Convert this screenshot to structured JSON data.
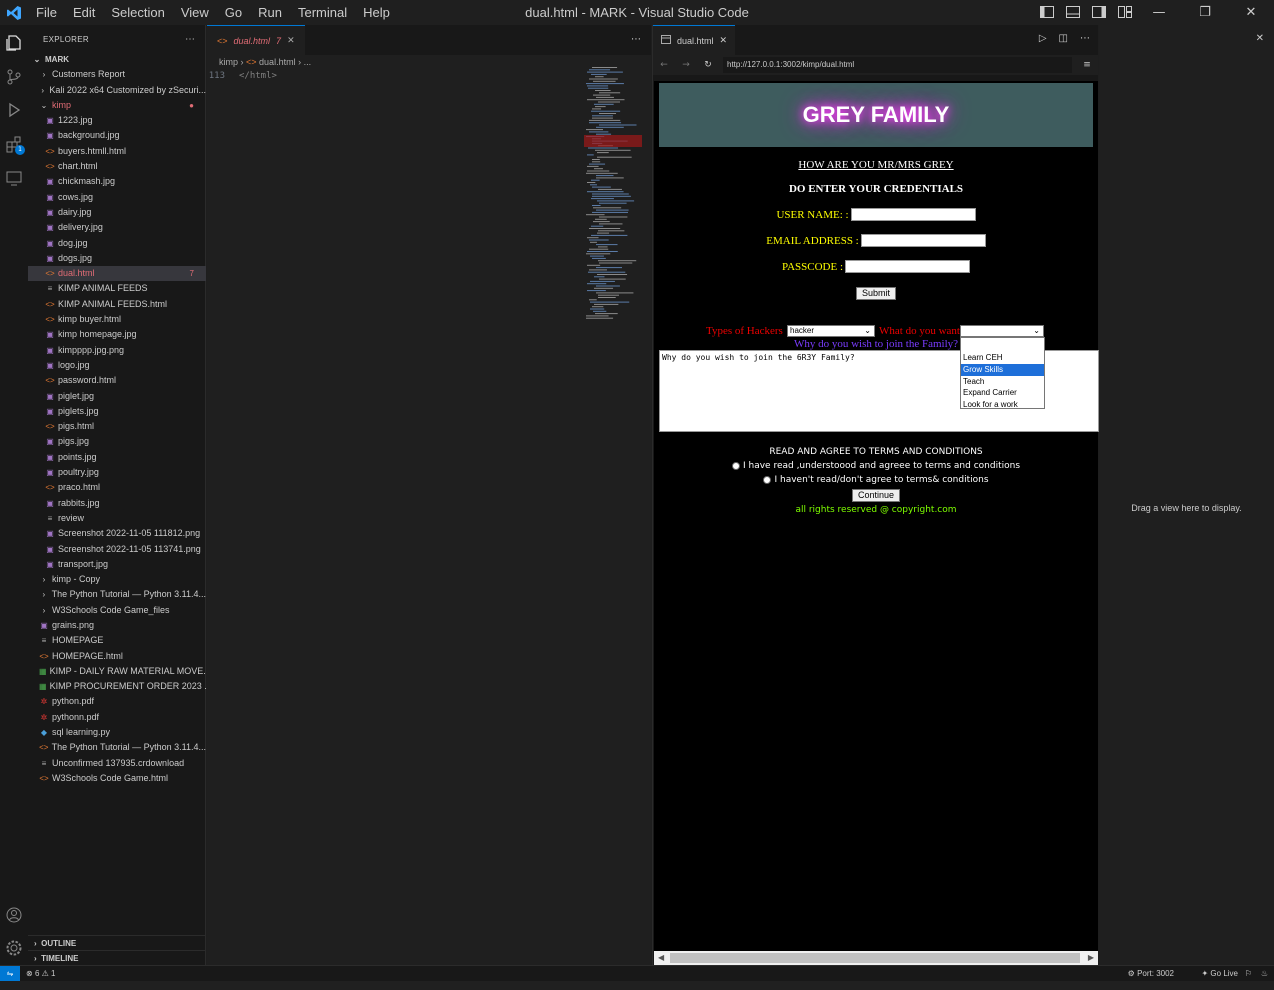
{
  "window": {
    "title": "dual.html - MARK - Visual Studio Code",
    "menu": [
      "File",
      "Edit",
      "Selection",
      "View",
      "Go",
      "Run",
      "Terminal",
      "Help"
    ]
  },
  "activity_bar": {
    "extensions_badge": "1"
  },
  "explorer": {
    "header": "EXPLORER",
    "root": "MARK",
    "items": [
      {
        "label": "Customers Report",
        "kind": "folder",
        "depth": 1
      },
      {
        "label": "Kali 2022 x64 Customized by zSecuri...",
        "kind": "folder",
        "depth": 1
      },
      {
        "label": "kimp",
        "kind": "folder-open",
        "depth": 1
      },
      {
        "label": "1223.jpg",
        "kind": "image",
        "depth": 2
      },
      {
        "label": "background.jpg",
        "kind": "image",
        "depth": 2
      },
      {
        "label": "buyers.htmll.html",
        "kind": "html",
        "depth": 2
      },
      {
        "label": "chart.html",
        "kind": "html",
        "depth": 2
      },
      {
        "label": "chickmash.jpg",
        "kind": "image",
        "depth": 2
      },
      {
        "label": "cows.jpg",
        "kind": "image",
        "depth": 2
      },
      {
        "label": "dairy.jpg",
        "kind": "image",
        "depth": 2
      },
      {
        "label": "delivery.jpg",
        "kind": "image",
        "depth": 2
      },
      {
        "label": "dog.jpg",
        "kind": "image",
        "depth": 2
      },
      {
        "label": "dogs.jpg",
        "kind": "image",
        "depth": 2
      },
      {
        "label": "dual.html",
        "kind": "html",
        "depth": 2,
        "badge": "7",
        "selected": true
      },
      {
        "label": "KIMP ANIMAL FEEDS",
        "kind": "text",
        "depth": 2
      },
      {
        "label": "KIMP ANIMAL FEEDS.html",
        "kind": "html",
        "depth": 2
      },
      {
        "label": "kimp buyer.html",
        "kind": "html",
        "depth": 2
      },
      {
        "label": "kimp homepage.jpg",
        "kind": "image",
        "depth": 2
      },
      {
        "label": "kimpppp.jpg.png",
        "kind": "image",
        "depth": 2
      },
      {
        "label": "logo.jpg",
        "kind": "image",
        "depth": 2
      },
      {
        "label": "password.html",
        "kind": "html",
        "depth": 2
      },
      {
        "label": "piglet.jpg",
        "kind": "image",
        "depth": 2
      },
      {
        "label": "piglets.jpg",
        "kind": "image",
        "depth": 2
      },
      {
        "label": "pigs.html",
        "kind": "html",
        "depth": 2
      },
      {
        "label": "pigs.jpg",
        "kind": "image",
        "depth": 2
      },
      {
        "label": "points.jpg",
        "kind": "image",
        "depth": 2
      },
      {
        "label": "poultry.jpg",
        "kind": "image",
        "depth": 2
      },
      {
        "label": "praco.html",
        "kind": "html",
        "depth": 2
      },
      {
        "label": "rabbits.jpg",
        "kind": "image",
        "depth": 2
      },
      {
        "label": "review",
        "kind": "text",
        "depth": 2
      },
      {
        "label": "Screenshot 2022-11-05 111812.png",
        "kind": "image",
        "depth": 2
      },
      {
        "label": "Screenshot 2022-11-05 113741.png",
        "kind": "image",
        "depth": 2
      },
      {
        "label": "transport.jpg",
        "kind": "image",
        "depth": 2
      },
      {
        "label": "kimp - Copy",
        "kind": "folder",
        "depth": 1
      },
      {
        "label": "The Python Tutorial — Python 3.11.4...",
        "kind": "folder",
        "depth": 1
      },
      {
        "label": "W3Schools Code Game_files",
        "kind": "folder",
        "depth": 1
      },
      {
        "label": "grains.png",
        "kind": "image",
        "depth": 1
      },
      {
        "label": "HOMEPAGE",
        "kind": "text",
        "depth": 1
      },
      {
        "label": "HOMEPAGE.html",
        "kind": "html",
        "depth": 1
      },
      {
        "label": "KIMP - DAILY RAW MATERIAL  MOVE...",
        "kind": "excel",
        "depth": 1
      },
      {
        "label": "KIMP PROCUREMENT ORDER  2023 ...",
        "kind": "excel",
        "depth": 1
      },
      {
        "label": "python.pdf",
        "kind": "pdf",
        "depth": 1
      },
      {
        "label": "pythonn.pdf",
        "kind": "pdf",
        "depth": 1
      },
      {
        "label": "sql learning.py",
        "kind": "python",
        "depth": 1
      },
      {
        "label": "The Python Tutorial — Python 3.11.4...",
        "kind": "html",
        "depth": 1
      },
      {
        "label": "Unconfirmed 137935.crdownload",
        "kind": "text",
        "depth": 1
      },
      {
        "label": "W3Schools Code Game.html",
        "kind": "html",
        "depth": 1
      }
    ],
    "outline": "OUTLINE",
    "timeline": "TIMELINE"
  },
  "editor": {
    "tab_label": "dual.html",
    "tab_badge": "7",
    "breadcrumb": [
      "kimp",
      "dual.html",
      "..."
    ],
    "line_number": "113",
    "line_text": "</html>"
  },
  "preview": {
    "tab_label": "dual.html",
    "url": "http://127.0.0.1:3002/kimp/dual.html",
    "page": {
      "banner": "GREY FAMILY",
      "greeting": "HOW ARE YOU MR/MRS GREY",
      "instruction": "DO ENTER YOUR CREDENTIALS",
      "username_label": "USER NAME: :",
      "email_label": "EMAIL ADDRESS :",
      "passcode_label": "PASSCODE :",
      "submit": "Submit",
      "hackers_label": "Types of Hackers",
      "hackers_value": "hacker",
      "want_label": "What do you want",
      "why_label": "Why do you wish to join the Family?",
      "textarea": "Why do you wish to join the  6R3Y Family?",
      "dropdown_options": [
        "Learn CEH",
        "Grow Skills",
        "Teach",
        "Expand Carrier",
        "Look for a work"
      ],
      "dropdown_highlight": "Grow Skills",
      "terms": "READ AND AGREE TO TERMS AND CONDITIONS",
      "radio1": "I have read ,understoood and agreee to terms and conditions",
      "radio2": "I haven't read/don't agree to terms& conditions",
      "continue": "Continue",
      "rights": "all rights reserved @ copyright.com"
    }
  },
  "right_pane": {
    "drag_text": "Drag a view here to display."
  },
  "status_bar": {
    "errors": "6",
    "warnings": "1",
    "port": "Port: 3002",
    "golive": "Go Live"
  },
  "colors": {
    "accent": "#0078d4",
    "banner_bg": "#3e5c5e",
    "banner_glow": "#ff3cff",
    "label_yellow": "#ffff00",
    "label_red": "#ee0000",
    "label_purple": "#7a3cff",
    "rights_green": "#7fff00"
  }
}
